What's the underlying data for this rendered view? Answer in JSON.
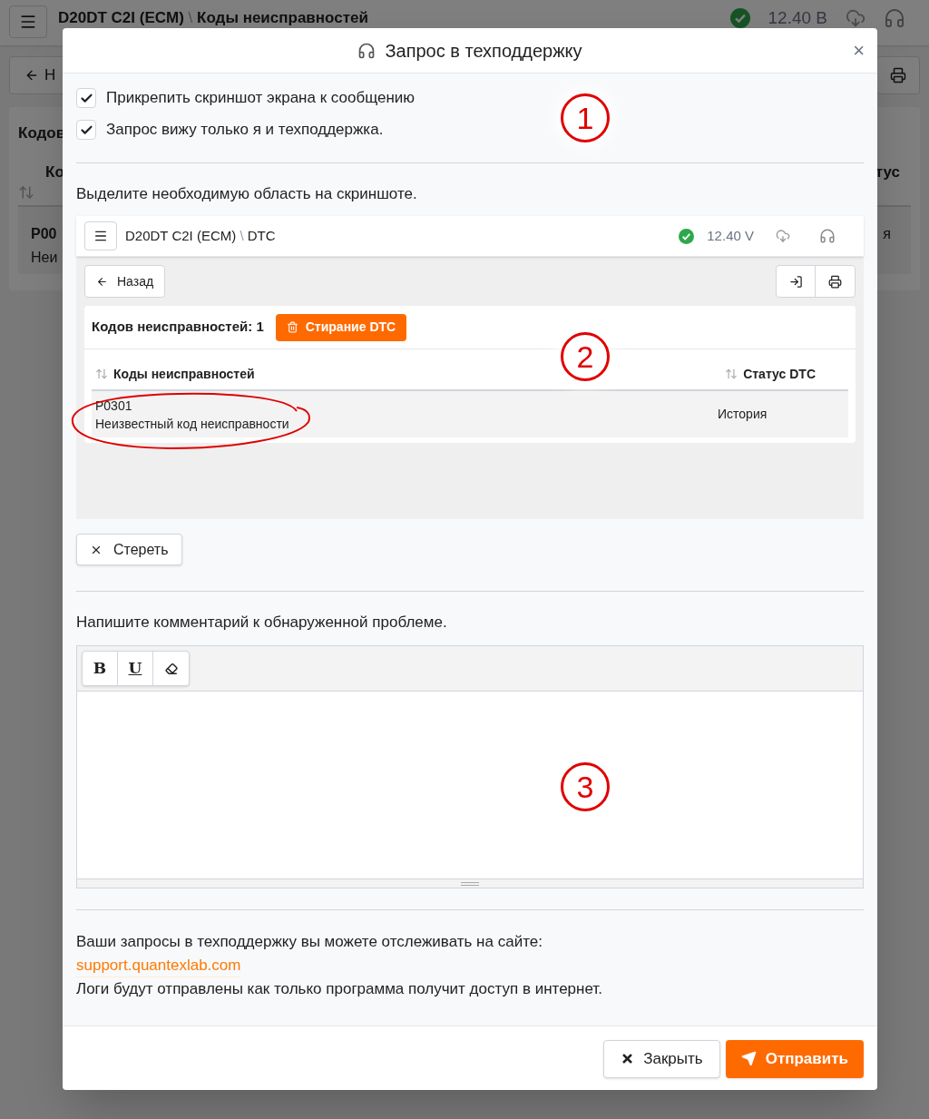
{
  "background": {
    "header": {
      "device": "D20DT C2I (ECM)",
      "separator": "\\",
      "page": "Коды неисправностей",
      "voltage": "12.40 В",
      "connected": true
    },
    "back_button": "Н",
    "count_label": "Кодов",
    "column_1": "Ко",
    "column_2": "тус",
    "row": {
      "code": "P00",
      "description": "Неи",
      "status": "я"
    }
  },
  "dialog": {
    "title": "Запрос в техподдержку",
    "close": "×",
    "options": [
      {
        "label": "Прикрепить скриншот экрана к сообщению",
        "checked": true
      },
      {
        "label": "Запрос вижу только я и техподдержка.",
        "checked": true
      }
    ],
    "select_hint": "Выделите необходимую область на скриншоте.",
    "screenshot": {
      "device": "D20DT C2I (ECM)",
      "separator": "\\",
      "page": "DTC",
      "voltage": "12.40 V",
      "connected": true,
      "back_button": "Назад",
      "count_label": "Кодов неисправностей: 1",
      "erase_button": "Стирание DTC",
      "columns": [
        "Коды неисправностей",
        "Статус DTC"
      ],
      "rows": [
        {
          "code": "P0301",
          "description": "Неизвестный код неисправности",
          "status": "История"
        }
      ]
    },
    "clear_button": "Стереть",
    "comment_hint": "Напишите комментарий к обнаруженной проблеме.",
    "editor": {
      "tools": [
        {
          "kind": "bold",
          "label": "B"
        },
        {
          "kind": "underline",
          "label": "U"
        },
        {
          "kind": "eraser"
        }
      ]
    },
    "info": {
      "line_1": "Ваши запросы в техподдержку вы можете отслеживать на сайте:",
      "link": "support.quantexlab.com",
      "line_2": "Логи будут отправлены как только программа получит доступ в интернет."
    },
    "annotations": [
      {
        "label": "1"
      },
      {
        "label": "2"
      },
      {
        "label": "3"
      }
    ],
    "buttons": [
      {
        "kind": "close",
        "label": "Закрыть"
      },
      {
        "kind": "send",
        "label": "Отправить"
      }
    ]
  }
}
